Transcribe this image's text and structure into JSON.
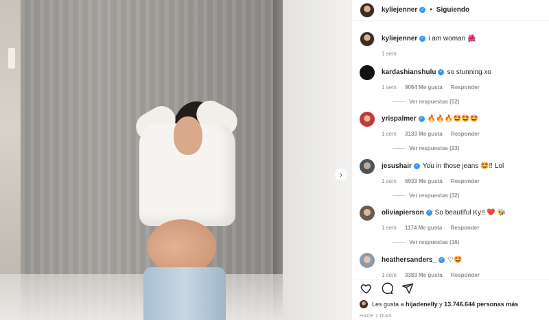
{
  "post": {
    "username": "kyliejenner",
    "follow_state": "Siguiendo",
    "dot": "•",
    "caption": "i am woman 🌺",
    "caption_age": "1 sem",
    "next_icon": "›"
  },
  "comments": [
    {
      "user": "kardashianshulu",
      "text": "so stunning xo",
      "age": "1 sem",
      "likes": "9064 Me gusta",
      "reply": "Responder",
      "replies": "Ver respuestas (52)"
    },
    {
      "user": "yrispalmer",
      "text": "🔥🔥🔥🤩🤩🤩",
      "age": "1 sem",
      "likes": "3133 Me gusta",
      "reply": "Responder",
      "replies": "Ver respuestas (23)"
    },
    {
      "user": "jesushair",
      "text": "You in those jeans 🤩!! Lol",
      "age": "1 sem",
      "likes": "6933 Me gusta",
      "reply": "Responder",
      "replies": "Ver respuestas (32)"
    },
    {
      "user": "oliviapierson",
      "text": "So beautiful Ky!! ❤️ 🐝",
      "age": "1 sem",
      "likes": "1174 Me gusta",
      "reply": "Responder",
      "replies": "Ver respuestas (16)"
    },
    {
      "user": "heathersanders_",
      "text": "♡🤩",
      "age": "1 sem",
      "likes": "3383 Me gusta",
      "reply": "Responder",
      "replies": ""
    }
  ],
  "likes_line": {
    "prefix": "Les gusta a",
    "user": "hijadenelly",
    "middle": "y",
    "count": "13.746.644 personas más"
  },
  "timestamp": "HACE 7 DÍAS",
  "icons": {
    "heart": "heart-icon",
    "comment": "comment-icon",
    "share": "share-icon",
    "verified": "verified-badge-icon"
  },
  "colors": {
    "verified": "#3897f0",
    "text": "#262626",
    "muted": "#8e8e8e"
  }
}
